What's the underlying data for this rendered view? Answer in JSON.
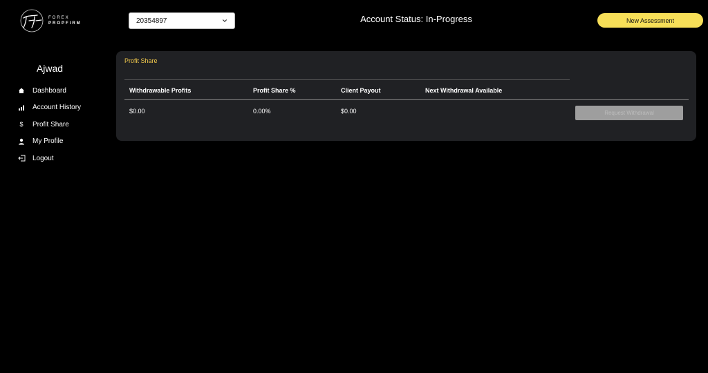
{
  "brand": {
    "line1": "FOREX",
    "line2": "PROPFIRM"
  },
  "account_select": {
    "value": "20354897"
  },
  "header": {
    "status": "Account Status: In-Progress",
    "new_assessment_label": "New Assessment"
  },
  "sidebar": {
    "user_name": "Ajwad",
    "items": [
      {
        "label": "Dashboard",
        "icon": "home-icon"
      },
      {
        "label": "Account History",
        "icon": "bar-chart-icon"
      },
      {
        "label": "Profit Share",
        "icon": "dollar-icon"
      },
      {
        "label": "My Profile",
        "icon": "user-icon"
      },
      {
        "label": "Logout",
        "icon": "logout-icon"
      }
    ]
  },
  "profit_share": {
    "title": "Profit Share",
    "columns": [
      "Withdrawable Profits",
      "Profit Share %",
      "Client Payout",
      "Next Withdrawal Available"
    ],
    "row": [
      "$0.00",
      "0.00%",
      "$0.00",
      ""
    ],
    "withdraw_label": "Request Withdrawal"
  },
  "colors": {
    "accent": "#f7df58",
    "title": "#f2c94c",
    "card_bg": "#202124",
    "page_bg": "#000000"
  }
}
